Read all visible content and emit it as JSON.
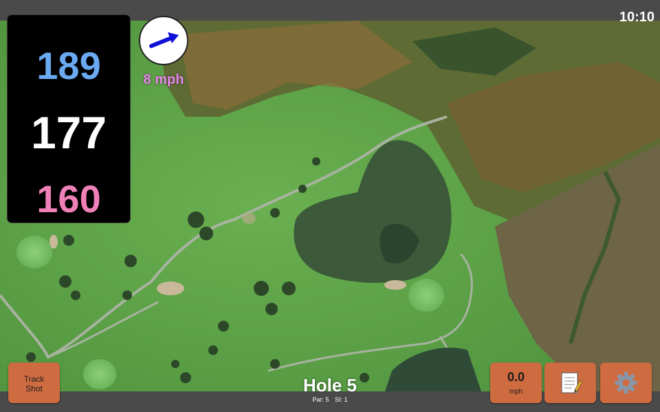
{
  "status_bar": {
    "time": "10:10"
  },
  "distances": {
    "back": "189",
    "middle": "177",
    "front": "160"
  },
  "wind": {
    "speed": "8 mph",
    "direction_icon": "arrow-right-icon"
  },
  "buttons": {
    "track_shot": {
      "line1": "Track",
      "line2": "Shot"
    },
    "speed": {
      "value": "0.0",
      "unit": "mph"
    },
    "notes": {
      "icon": "notepad-icon"
    },
    "settings": {
      "icon": "gear-icon"
    }
  },
  "hole": {
    "title": "Hole 5",
    "par": "Par: 5",
    "stroke_index": "SI: 1"
  },
  "colors": {
    "back_distance": "#6aaaf2",
    "middle_distance": "#ffffff",
    "front_distance": "#f080b8",
    "button": "#cf6b40",
    "wind_text": "#e58ae6"
  }
}
